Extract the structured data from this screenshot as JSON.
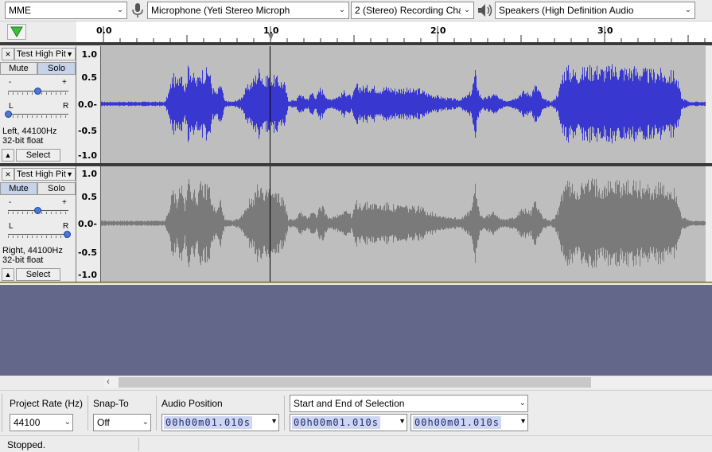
{
  "device_toolbar": {
    "host": "MME",
    "recording_device": "Microphone (Yeti Stereo Microph",
    "recording_channels": "2 (Stereo) Recording Chai",
    "playback_device": "Speakers (High Definition Audio",
    "mic_icon": "microphone-icon",
    "speaker_icon": "speaker-icon"
  },
  "timeline": {
    "ticks": [
      "0.0",
      "1.0",
      "2.0",
      "3.0"
    ],
    "play_icon": "play-triangle-icon"
  },
  "tracks": [
    {
      "name": "Test High Pit",
      "close": "×",
      "mute": "Mute",
      "solo": "Solo",
      "gain_minus": "-",
      "gain_plus": "+",
      "pan_left": "L",
      "pan_right": "R",
      "info_line1": "Left, 44100Hz",
      "info_line2": "32-bit float",
      "select": "Select",
      "scale": [
        "1.0",
        "0.5",
        "0.0-",
        "-0.5",
        "-1.0"
      ],
      "color": "#3838d0",
      "mute_active": false,
      "solo_active": true,
      "gain_level": 0.5,
      "pan_level": 0.0
    },
    {
      "name": "Test High Pit",
      "close": "×",
      "mute": "Mute",
      "solo": "Solo",
      "gain_minus": "-",
      "gain_plus": "+",
      "pan_left": "L",
      "pan_right": "R",
      "info_line1": "Right, 44100Hz",
      "info_line2": "32-bit float",
      "select": "Select",
      "scale": [
        "1.0",
        "0.5",
        "0.0-",
        "-0.5",
        "-1.0"
      ],
      "color": "#7a7a7a",
      "mute_active": true,
      "solo_active": false,
      "gain_level": 0.5,
      "pan_level": 1.0
    }
  ],
  "selection_toolbar": {
    "project_rate_label": "Project Rate (Hz)",
    "project_rate": "44100",
    "snap_to_label": "Snap-To",
    "snap_to": "Off",
    "audio_position_label": "Audio Position",
    "audio_position": "00h00m01.010s",
    "selection_mode": "Start and End of Selection",
    "selection_start": "00h00m01.010s",
    "selection_end": "00h00m01.010s"
  },
  "status": {
    "text": "Stopped."
  },
  "colors": {
    "empty_area": "#63688a",
    "waveform_bg": "#bebebe",
    "time_digits_bg": "#cfd6f0"
  }
}
